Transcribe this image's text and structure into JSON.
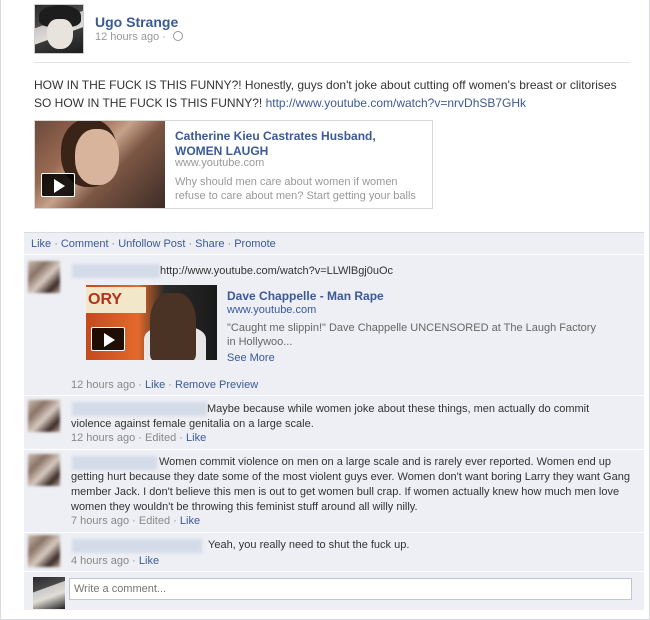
{
  "post": {
    "author": "Ugo Strange",
    "time": "12 hours ago",
    "privacy_icon": "globe-icon",
    "text": "HOW IN THE FUCK IS THIS FUNNY?! Honestly, guys don't joke about cutting off women's breast or clitorises SO HOW IN THE FUCK IS THIS FUNNY?!",
    "url": "http://www.youtube.com/watch?v=nrvDhSB7GHk",
    "share": {
      "title": "Catherine Kieu Castrates Husband, WOMEN LAUGH",
      "domain": "www.youtube.com",
      "description": "Why should men care about women if women refuse to care about men? Start getting your balls"
    },
    "actions": [
      "Like",
      "Comment",
      "Unfollow Post",
      "Share",
      "Promote"
    ]
  },
  "comments": [
    {
      "text": "http://www.youtube.com/watch?v=LLWlBgj0uOc",
      "time": "12 hours ago",
      "links": [
        "Like",
        "Remove Preview"
      ],
      "preview": {
        "thumb_text": "ORY",
        "title": "Dave Chappelle - Man Rape",
        "domain": "www.youtube.com",
        "description": "\"Caught me slippin!\" Dave Chappelle UNCENSORED at The Laugh Factory in Hollywoo...",
        "more": "See More"
      }
    },
    {
      "text": "Maybe because while women joke about these things, men actually do commit violence against female genitalia on a large scale.",
      "time": "12 hours ago",
      "edited": "Edited",
      "links": [
        "Like"
      ]
    },
    {
      "text": "Women commit violence on men on a large scale and is rarely ever reported. Women end up getting hurt because they date some of the most violent guys ever. Women don't want boring Larry they want Gang member Jack. I don't believe this men is out to get women bull crap. If women actually knew how much men love women they wouldn't be throwing this feminist stuff around all willy nilly.",
      "time": "7 hours ago",
      "edited": "Edited",
      "links": [
        "Like"
      ]
    },
    {
      "text": "Yeah, you really need to shut the fuck up.",
      "time": "4 hours ago",
      "links": [
        "Like"
      ]
    }
  ],
  "composer": {
    "placeholder": "Write a comment..."
  },
  "colors": {
    "link": "#3b5998",
    "comment_bg": "#edeff4",
    "muted": "#999999"
  }
}
